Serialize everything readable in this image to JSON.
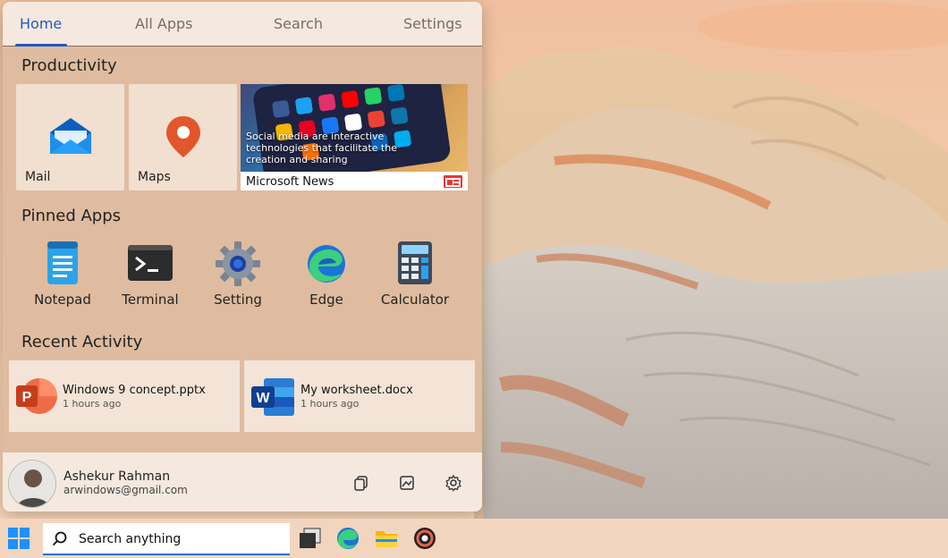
{
  "nav": {
    "tabs": [
      {
        "label": "Home",
        "active": true
      },
      {
        "label": "All Apps",
        "active": false
      },
      {
        "label": "Search",
        "active": false
      },
      {
        "label": "Settings",
        "active": false
      }
    ]
  },
  "productivity": {
    "title": "Productivity",
    "tiles": [
      {
        "label": "Mail",
        "icon": "mail-icon"
      },
      {
        "label": "Maps",
        "icon": "map-pin-icon"
      }
    ],
    "news": {
      "caption": "Social media are interactive technologies that facilitate the creation and sharing",
      "label": "Microsoft News",
      "icon": "news-icon"
    }
  },
  "pinned": {
    "title": "Pinned Apps",
    "apps": [
      {
        "label": "Notepad",
        "icon": "notepad-icon"
      },
      {
        "label": "Terminal",
        "icon": "terminal-icon"
      },
      {
        "label": "Setting",
        "icon": "gear-icon"
      },
      {
        "label": "Edge",
        "icon": "edge-icon"
      },
      {
        "label": "Calculator",
        "icon": "calculator-icon"
      }
    ]
  },
  "recent": {
    "title": "Recent Activity",
    "items": [
      {
        "name": "Windows 9 concept.pptx",
        "time": "1 hours ago",
        "icon": "powerpoint-icon"
      },
      {
        "name": "My worksheet.docx",
        "time": "1 hours ago",
        "icon": "word-icon"
      }
    ]
  },
  "user": {
    "name": "Ashekur Rahman",
    "email": "arwindows@gmail.com"
  },
  "taskbar": {
    "search_placeholder": "Search anything"
  },
  "colors": {
    "accent": "#1f5bbf",
    "panel": "#dfbc9f",
    "tile": "#f1dfd0"
  }
}
